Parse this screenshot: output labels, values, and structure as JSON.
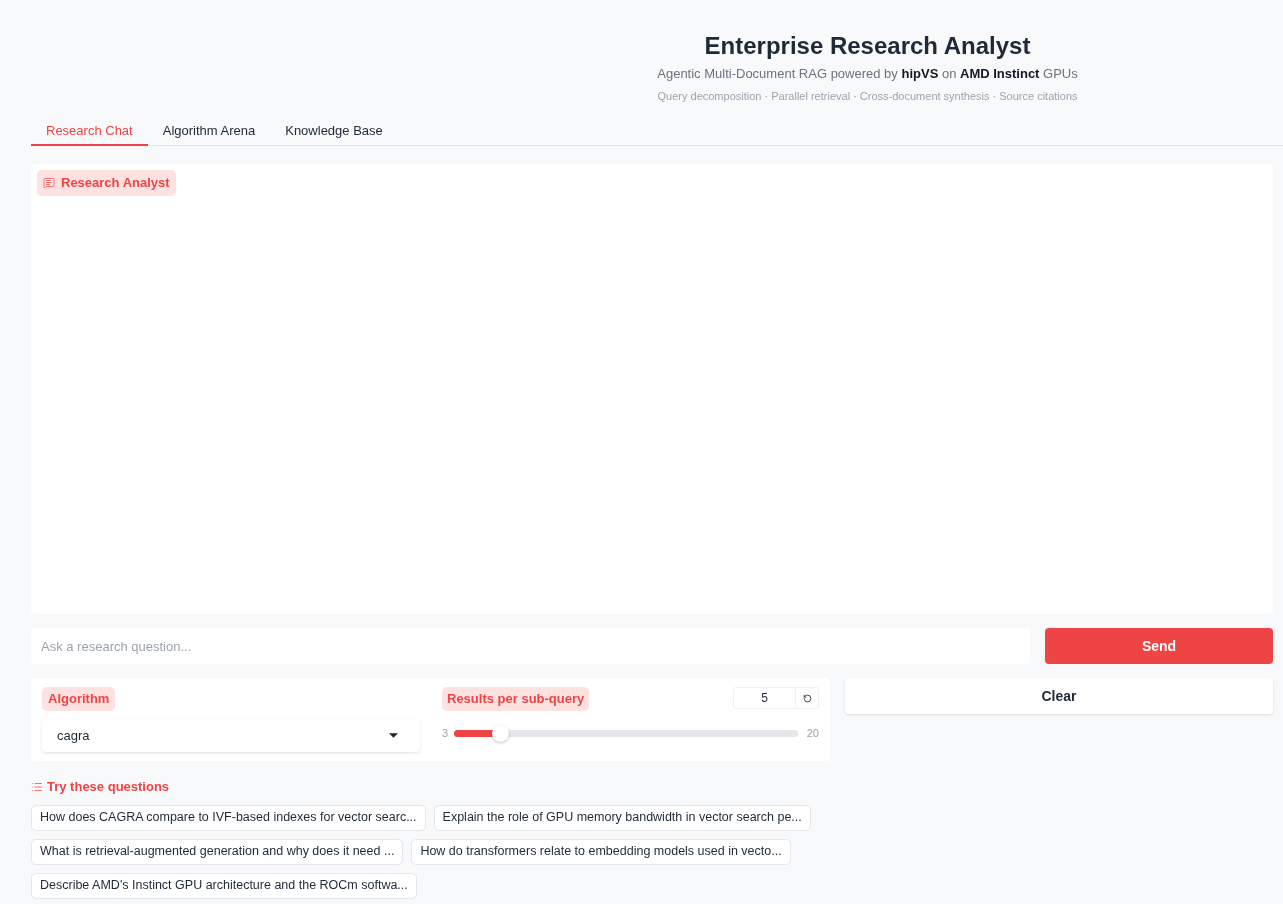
{
  "header": {
    "title": "Enterprise Research Analyst",
    "subtitle": "Agentic Multi-Document RAG powered by **hipVS** on **AMD Instinct** GPUs",
    "features": "Query decomposition · Parallel retrieval · Cross-document synthesis · Source citations"
  },
  "tabs": [
    {
      "label": "Research Chat",
      "selected": true
    },
    {
      "label": "Algorithm Arena",
      "selected": false
    },
    {
      "label": "Knowledge Base",
      "selected": false
    }
  ],
  "chat": {
    "label": "Research Analyst"
  },
  "composer": {
    "placeholder": "Ask a research question...",
    "send_button": "Send"
  },
  "settings": {
    "algorithm": {
      "label": "Algorithm",
      "value": "cagra"
    },
    "results_per_subquery": {
      "label": "Results per sub-query",
      "value": "5",
      "min": "3",
      "max": "20",
      "level": 0.118
    }
  },
  "clear_button": "Clear",
  "examples": {
    "title": "Try these questions",
    "questions": [
      "How does CAGRA compare to IVF-based indexes for vector searc...",
      "Explain the role of GPU memory bandwidth in vector search pe...",
      "What is retrieval-augmented generation and why does it need ...",
      "How do transformers relate to embedding models used in vecto...",
      "Describe AMD's Instinct GPU architecture and the ROCm softwa..."
    ]
  }
}
